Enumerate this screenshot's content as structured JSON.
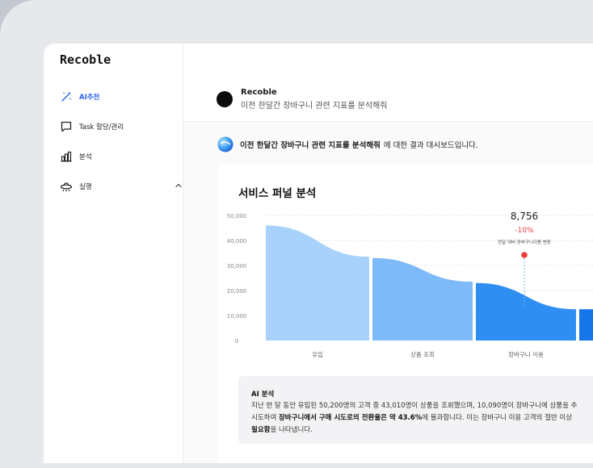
{
  "app": {
    "logo": "Recoble"
  },
  "sidebar": {
    "items": [
      {
        "label": "AI추천",
        "icon": "magic-wand-icon",
        "active": true
      },
      {
        "label": "Task 할당/관리",
        "icon": "chat-bubble-icon",
        "active": false
      },
      {
        "label": "분석",
        "icon": "bar-chart-icon",
        "active": false
      },
      {
        "label": "실행",
        "icon": "ufo-icon",
        "active": false,
        "expand_icon": "chevron-up-icon"
      }
    ]
  },
  "prompt": {
    "sender": "Recoble",
    "text": "이전 한달간 장바구니 관련 지표를 분석해줘"
  },
  "result": {
    "query_bold": "이전 한달간 장바구니 관련 지표를 분석해줘",
    "suffix": "에 대한 결과 대시보드입니다."
  },
  "card": {
    "title": "서비스 퍼널 분석",
    "annotation": {
      "value": "8,756",
      "change": "-10%",
      "caption": "전달 대비 장바구니이용 변동"
    },
    "ai": {
      "title": "AI 분석",
      "line1": "지난 한 달 동안 유입된 50,200명의 고객 중 43,010명이 상품을 조회했으며, 10,090명이 장바구니에 상품을 추",
      "line2_pre": "시도하여 ",
      "line2_bold": "장바구니에서 구매 시도로의 전환율은 약 43.6%",
      "line2_post": "에 불과합니다. 이는 장바구니 이용 고객의 절반 이상",
      "line3_bold": "필요함",
      "line3_post": "을 나타냅니다."
    }
  },
  "chart_data": {
    "type": "area",
    "categories": [
      "유입",
      "상품 조회",
      "장바구니 이용",
      ""
    ],
    "y_ticks": [
      "50,000",
      "40,000",
      "30,000",
      "20,000",
      "10,000",
      "0"
    ],
    "ylim": [
      0,
      50000
    ],
    "stages": [
      {
        "label": "유입",
        "start": 46000,
        "end": 33500,
        "color": "#a8d2fb"
      },
      {
        "label": "상품 조회",
        "start": 33000,
        "end": 23500,
        "color": "#7cbaf8"
      },
      {
        "label": "장바구니 이용",
        "start": 23000,
        "end": 12500,
        "color": "#2f8ef2"
      },
      {
        "label": "",
        "start": 12500,
        "end": 12000,
        "color": "#1476e8"
      }
    ],
    "grid": true,
    "colors": {
      "accent": "#2a62e8",
      "marker": "#ef3b3b",
      "change_text": "#ef3b3b"
    }
  }
}
